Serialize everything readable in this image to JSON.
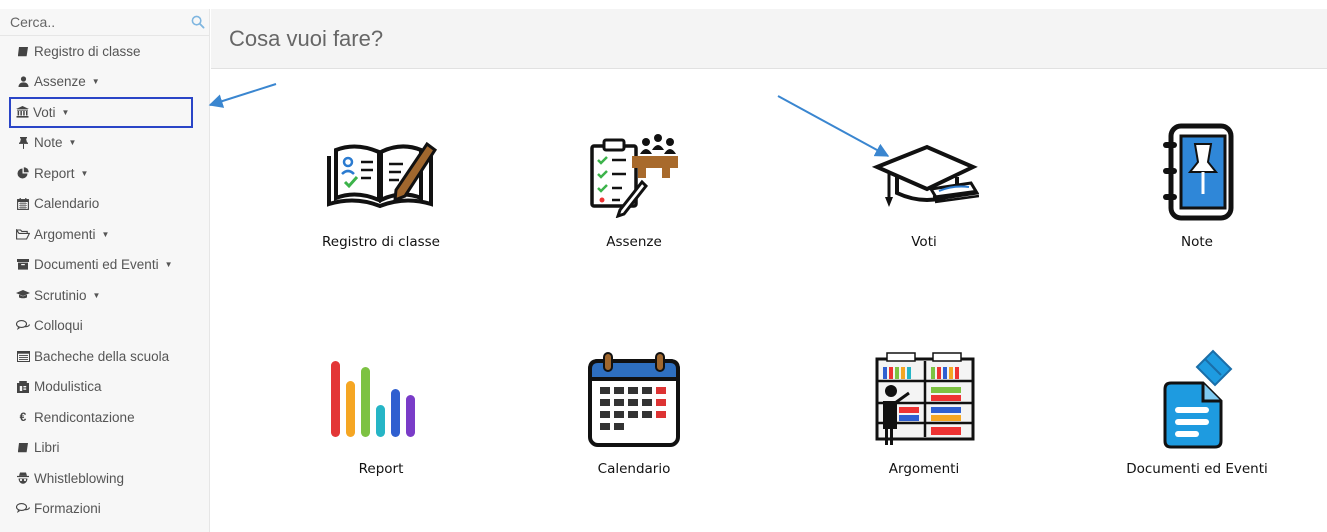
{
  "search": {
    "placeholder": "Cerca.."
  },
  "sidebar": {
    "items": [
      {
        "label": "Registro di classe",
        "icon": "book-icon",
        "caret": ""
      },
      {
        "label": "Assenze",
        "icon": "user-icon",
        "caret": "▼"
      },
      {
        "label": "Voti",
        "icon": "bank-icon",
        "caret": "▼"
      },
      {
        "label": "Note",
        "icon": "pin-icon",
        "caret": "▼"
      },
      {
        "label": "Report",
        "icon": "pie-chart-icon",
        "caret": "▼"
      },
      {
        "label": "Calendario",
        "icon": "calendar-icon",
        "caret": ""
      },
      {
        "label": "Argomenti",
        "icon": "folder-icon",
        "caret": "▼"
      },
      {
        "label": "Documenti ed Eventi",
        "icon": "archive-icon",
        "caret": "▼"
      },
      {
        "label": "Scrutinio",
        "icon": "graduation-cap-icon",
        "caret": "▼"
      },
      {
        "label": "Colloqui",
        "icon": "chat-icon",
        "caret": ""
      },
      {
        "label": "Bacheche della scuola",
        "icon": "list-icon",
        "caret": ""
      },
      {
        "label": "Modulistica",
        "icon": "forms-icon",
        "caret": ""
      },
      {
        "label": "Rendicontazione",
        "icon": "euro-icon",
        "caret": ""
      },
      {
        "label": "Libri",
        "icon": "book-icon",
        "caret": ""
      },
      {
        "label": "Whistleblowing",
        "icon": "anonymous-icon",
        "caret": ""
      },
      {
        "label": "Formazioni",
        "icon": "chat-icon",
        "caret": ""
      }
    ]
  },
  "main": {
    "title": "Cosa vuoi fare?",
    "tiles": [
      {
        "label": "Registro di classe",
        "icon": "open-book-icon"
      },
      {
        "label": "Assenze",
        "icon": "clipboard-checklist-icon"
      },
      {
        "label": "Voti",
        "icon": "graduation-cap-icon"
      },
      {
        "label": "Note",
        "icon": "notebook-pin-icon"
      },
      {
        "label": "Report",
        "icon": "bar-chart-icon"
      },
      {
        "label": "Calendario",
        "icon": "calendar-icon"
      },
      {
        "label": "Argomenti",
        "icon": "bookshelf-icon"
      },
      {
        "label": "Documenti ed Eventi",
        "icon": "document-icon"
      }
    ]
  },
  "colors": {
    "highlight": "#2a45c7",
    "arrow": "#3a86d0",
    "calendar": "#2e6fc0",
    "document": "#1e9be0"
  }
}
